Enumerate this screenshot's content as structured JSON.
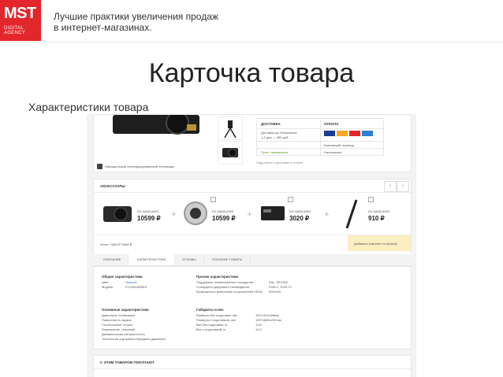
{
  "header": {
    "logo_text": "MST",
    "logo_subtext": "DIGITAL AGENCY",
    "tagline_line1": "Лучшие практики увеличения продаж",
    "tagline_line2": "в интернет-магазинах.",
    "accent_color": "#e2262b"
  },
  "slide": {
    "title": "Карточка товара",
    "subtitle": "Характеристики товара"
  },
  "screenshot": {
    "delivery": {
      "col1_header": "ДОСТАВКА",
      "col2_header": "ОПЛАТА",
      "row1_text": "Доставка до Ульяновска",
      "row1_sub": "1-2 дня — 590 руб.",
      "row2_col2": "Банковский перевод",
      "row3_col1": "Пункт самовывоза",
      "row3_col2": "Наличными",
      "note": "Подробнее о доставке и оплате"
    },
    "banner_text": "Официальный сертифицированный поставщик",
    "accessories": {
      "title": "АКСЕССУАРЫ",
      "items": [
        {
          "name": "DX-NA65 A903",
          "price": "10599 ₽"
        },
        {
          "name": "DX-NA65 A903",
          "price": "10599 ₽"
        },
        {
          "name": "DX-NA65 A903",
          "price": "3020 ₽"
        },
        {
          "name": "DX-NA65 A903",
          "price": "910 ₽"
        }
      ],
      "total_label": "Итого: НАБОР 6566 ₽",
      "add_button": "Добавить комплект в корзину"
    },
    "tabs": [
      "ОПИСАНИЕ",
      "ХАРАКТЕРИСТИКИ",
      "ОТЗЫВЫ",
      "ПОХОЖИЕ ТОВАРЫ"
    ],
    "specs": {
      "general_title": "Общие характеристики",
      "general_rows": [
        {
          "label": "Цвет",
          "value": "Черный"
        },
        {
          "label": "Модель",
          "value": "FZ-DMC800EK"
        }
      ],
      "other_title": "Прочие характеристики",
      "other_rows": [
        {
          "label": "Поддержка телевизионных стандартов",
          "value": "PAL, SECAM"
        },
        {
          "label": "Стандарты цифрового телевидения",
          "value": "DVB-C, DVB-T2"
        },
        {
          "label": "Возможность крепления на кронштейн VESA",
          "value": "400x400"
        }
      ],
      "main_title": "Основные характеристики",
      "main_rows": [
        {
          "label": "Диагональ телевизора"
        },
        {
          "label": "Поверхность экрана"
        },
        {
          "label": "Соотношение сторон"
        },
        {
          "label": "Разрешение, пикселей"
        },
        {
          "label": "Динамическая контрастность"
        },
        {
          "label": "Технология улучшения передачи движения"
        }
      ],
      "size_title": "Габариты и вес",
      "size_rows": [
        {
          "label": "Размеры без подставки, мм",
          "value": "1007x610x58мм"
        },
        {
          "label": "Размеры с подставкой, мм",
          "value": "1007x665x233 мм"
        },
        {
          "label": "Вес без подставки, кг",
          "value": "13,6"
        },
        {
          "label": "Вес с подставкой, кг",
          "value": "14,0"
        }
      ]
    },
    "also_bought": "С ЭТИМ ТОВАРОМ ПОКУПАЮТ"
  }
}
